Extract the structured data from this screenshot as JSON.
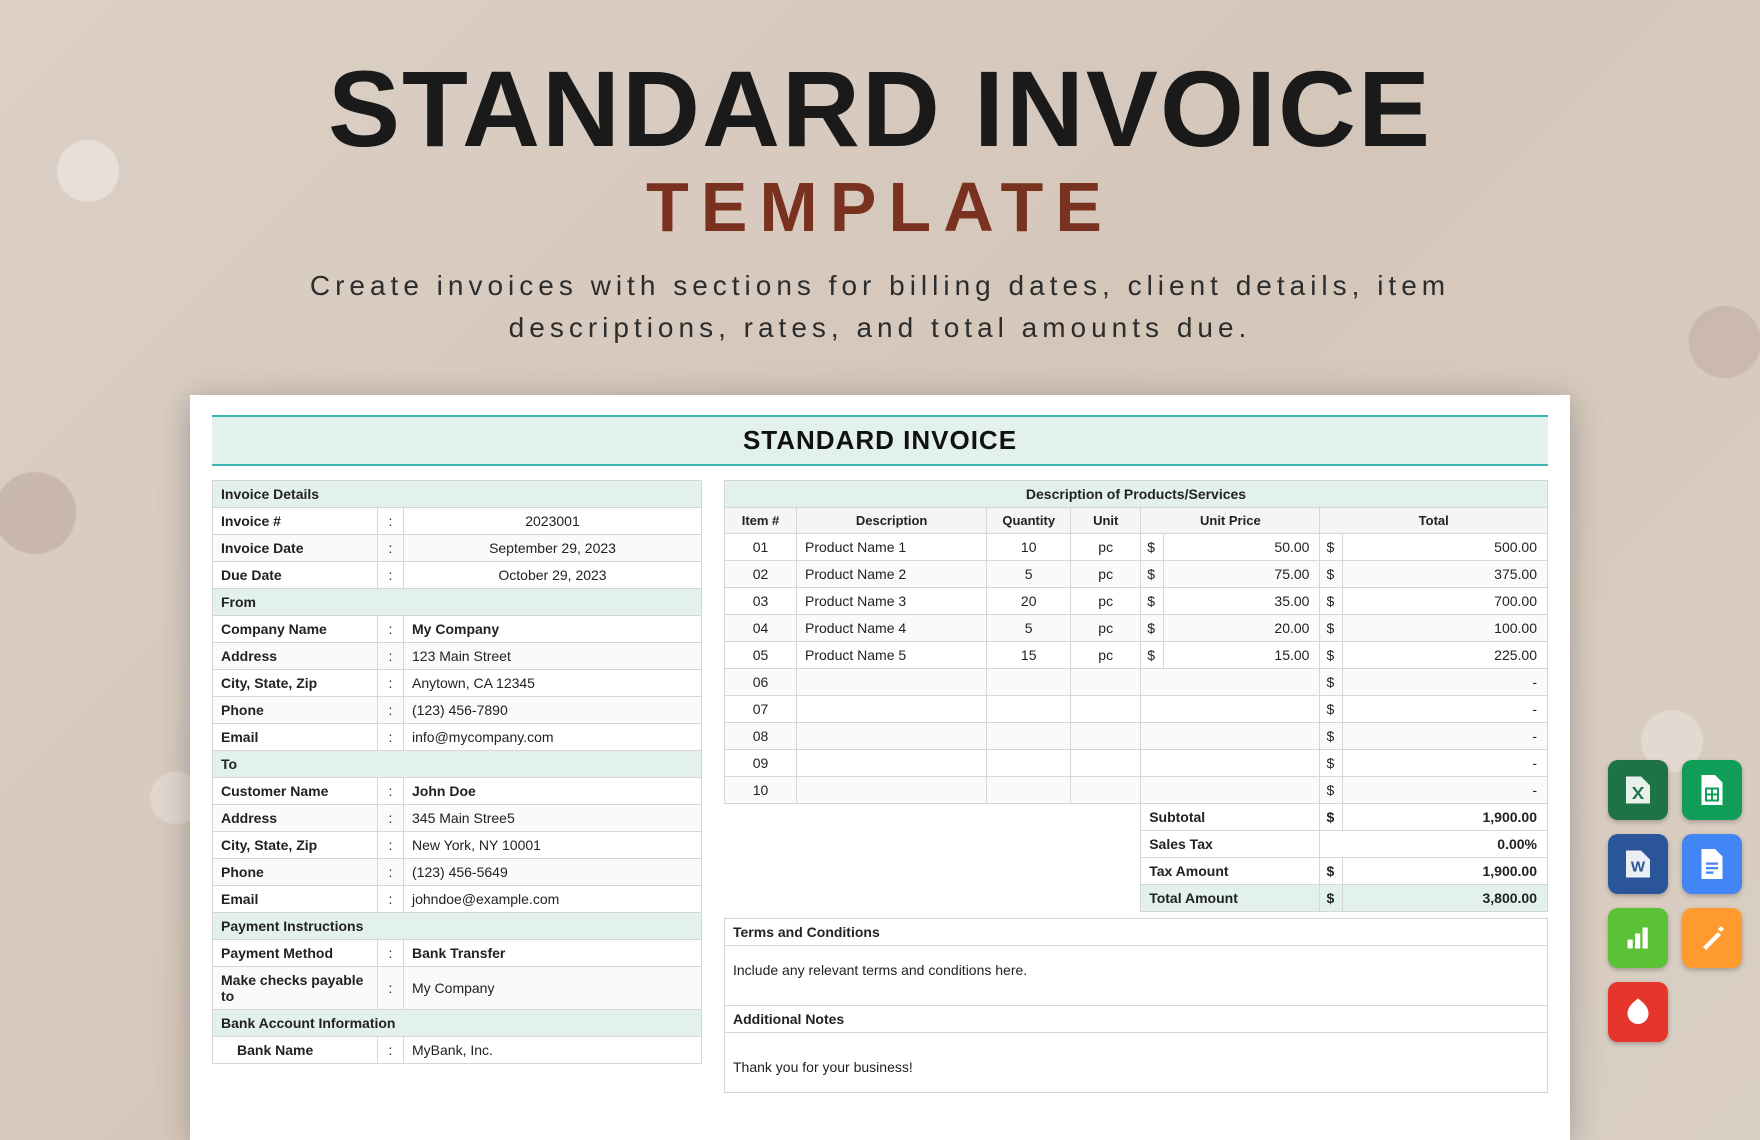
{
  "hero": {
    "title": "STANDARD INVOICE",
    "subtitle": "TEMPLATE",
    "tagline1": "Create invoices with sections for billing dates, client details, item",
    "tagline2": "descriptions, rates, and total amounts due."
  },
  "sheet": {
    "title": "STANDARD INVOICE"
  },
  "details": {
    "header": "Invoice Details",
    "rows": [
      {
        "label": "Invoice #",
        "value": "2023001",
        "center": true
      },
      {
        "label": "Invoice Date",
        "value": "September 29, 2023",
        "center": true
      },
      {
        "label": "Due Date",
        "value": "October 29, 2023",
        "center": true
      }
    ]
  },
  "from": {
    "header": "From",
    "rows": [
      {
        "label": "Company Name",
        "value": "My Company",
        "bold": true
      },
      {
        "label": "Address",
        "value": "123 Main Street"
      },
      {
        "label": "City, State, Zip",
        "value": "Anytown, CA 12345"
      },
      {
        "label": "Phone",
        "value": "(123) 456-7890"
      },
      {
        "label": "Email",
        "value": "info@mycompany.com"
      }
    ]
  },
  "to": {
    "header": "To",
    "rows": [
      {
        "label": "Customer Name",
        "value": "John Doe",
        "bold": true
      },
      {
        "label": "Address",
        "value": "345 Main Stree5"
      },
      {
        "label": "City, State, Zip",
        "value": "New York, NY 10001"
      },
      {
        "label": "Phone",
        "value": "(123) 456-5649"
      },
      {
        "label": "Email",
        "value": "johndoe@example.com"
      }
    ]
  },
  "pay": {
    "header": "Payment Instructions",
    "rows": [
      {
        "label": "Payment Method",
        "value": "Bank Transfer",
        "bold": true
      },
      {
        "label": "Make checks payable to",
        "value": "My Company"
      }
    ],
    "bank_header": "Bank Account Information",
    "bank_rows": [
      {
        "label": "Bank Name",
        "value": "MyBank, Inc."
      }
    ]
  },
  "items": {
    "header": "Description of Products/Services",
    "cols": {
      "item": "Item #",
      "desc": "Description",
      "qty": "Quantity",
      "unit": "Unit",
      "price": "Unit Price",
      "total": "Total"
    },
    "rows": [
      {
        "no": "01",
        "desc": "Product Name 1",
        "qty": "10",
        "unit": "pc",
        "price": "50.00",
        "total": "500.00"
      },
      {
        "no": "02",
        "desc": "Product Name 2",
        "qty": "5",
        "unit": "pc",
        "price": "75.00",
        "total": "375.00"
      },
      {
        "no": "03",
        "desc": "Product Name 3",
        "qty": "20",
        "unit": "pc",
        "price": "35.00",
        "total": "700.00"
      },
      {
        "no": "04",
        "desc": "Product Name 4",
        "qty": "5",
        "unit": "pc",
        "price": "20.00",
        "total": "100.00"
      },
      {
        "no": "05",
        "desc": "Product Name 5",
        "qty": "15",
        "unit": "pc",
        "price": "15.00",
        "total": "225.00"
      },
      {
        "no": "06",
        "desc": "",
        "qty": "",
        "unit": "",
        "price": "",
        "total": "-"
      },
      {
        "no": "07",
        "desc": "",
        "qty": "",
        "unit": "",
        "price": "",
        "total": "-"
      },
      {
        "no": "08",
        "desc": "",
        "qty": "",
        "unit": "",
        "price": "",
        "total": "-"
      },
      {
        "no": "09",
        "desc": "",
        "qty": "",
        "unit": "",
        "price": "",
        "total": "-"
      },
      {
        "no": "10",
        "desc": "",
        "qty": "",
        "unit": "",
        "price": "",
        "total": "-"
      }
    ],
    "subtotal_l": "Subtotal",
    "subtotal_v": "1,900.00",
    "tax_l": "Sales Tax",
    "tax_v": "0.00%",
    "taxamt_l": "Tax Amount",
    "taxamt_v": "1,900.00",
    "total_l": "Total Amount",
    "total_v": "3,800.00"
  },
  "terms": {
    "header": "Terms and Conditions",
    "body": "Include any relevant terms and conditions here."
  },
  "notes": {
    "header": "Additional Notes",
    "body": "Thank you for your business!"
  },
  "cur": "$"
}
